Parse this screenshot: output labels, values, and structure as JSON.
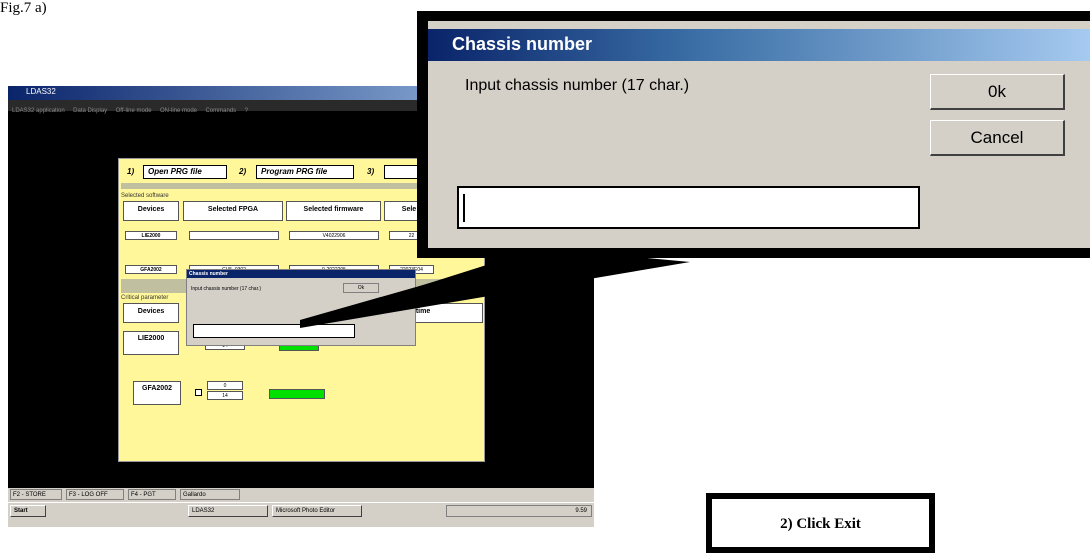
{
  "figure_label": "Fig.7 a)",
  "small_screen": {
    "window_title": "LDAS32",
    "menu": [
      "LDAS32 application",
      "Data Display",
      "Off-line mode",
      "ON-line mode",
      "Commands",
      "?"
    ],
    "toolbar": [
      {
        "num": "1)",
        "label": "Open PRG file"
      },
      {
        "num": "2)",
        "label": "Program PRG file"
      },
      {
        "num": "3)",
        "label": ""
      }
    ],
    "selected_software_label": "Selected software",
    "columns": [
      "Devices",
      "Selected FPGA",
      "Selected firmware",
      "Sele"
    ],
    "rows": [
      {
        "device": "LIE2000",
        "fpga": "",
        "firmware": "V4022906",
        "other": "22"
      },
      {
        "device": "GFA2002",
        "fpga": "GV5_0302",
        "firmware": "0-2022205",
        "other": "22023E04"
      }
    ],
    "critical_label": "Critical parameter",
    "critical_col_device": "Devices",
    "critical_col_time": "k time",
    "critical_rows": [
      {
        "device": "LIE2000",
        "v1": "",
        "v2": "14"
      },
      {
        "device": "GFA2002",
        "v1": "0",
        "v2": "14"
      }
    ],
    "small_dialog": {
      "title": "Chassis number",
      "prompt": "Input chassis number (17 char.)",
      "ok": "Ok"
    },
    "fkeys": [
      "F2 - STORE",
      "F3 - LOG OFF",
      "F4 - PGT",
      "Gallardo"
    ],
    "taskbar": {
      "start": "Start",
      "apps": [
        "LDAS32",
        "Microsoft Photo Editor"
      ],
      "clock": "9.59"
    }
  },
  "dialog": {
    "title": "Chassis number",
    "prompt": "Input chassis number (17 char.)",
    "ok_label": "0k",
    "cancel_label": "Cancel",
    "input_value": ""
  },
  "callout_text": "2) Click Exit",
  "colors": {
    "titlebar": "#0a246a",
    "panel": "#fff79a",
    "status_green": "#00e000",
    "dialog_bg": "#d4d0c8"
  }
}
